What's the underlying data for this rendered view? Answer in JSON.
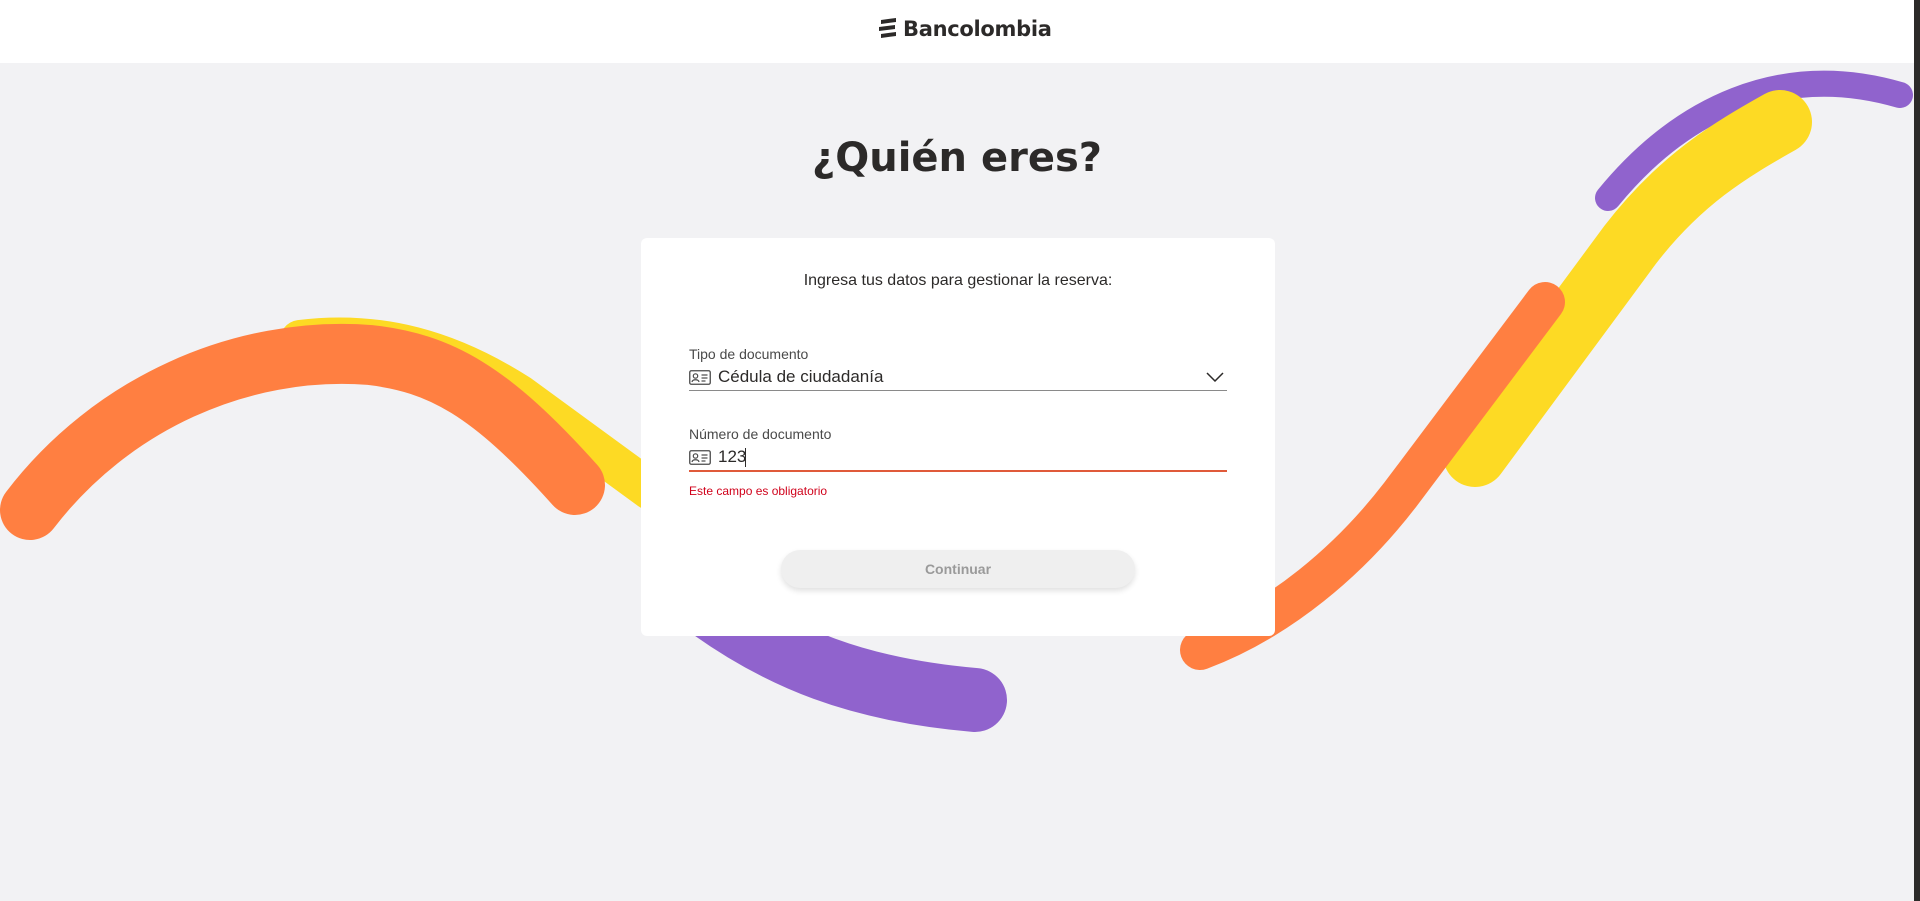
{
  "header": {
    "brand": "Bancolombia"
  },
  "main": {
    "title": "¿Quién eres?",
    "intro": "Ingresa tus datos para gestionar la reserva:"
  },
  "form": {
    "document_type": {
      "label": "Tipo de documento",
      "value": "Cédula de ciudadanía",
      "icon": "id-card-icon"
    },
    "document_number": {
      "label": "Número de documento",
      "value": "123",
      "icon": "id-card-icon",
      "error": "Este campo es obligatorio"
    },
    "continue_label": "Continuar"
  },
  "colors": {
    "background": "#f2f2f4",
    "yellow": "#fdda24",
    "orange": "#ff7f41",
    "purple": "#9063cd",
    "error": "#d0021b",
    "text": "#2c2a29"
  }
}
